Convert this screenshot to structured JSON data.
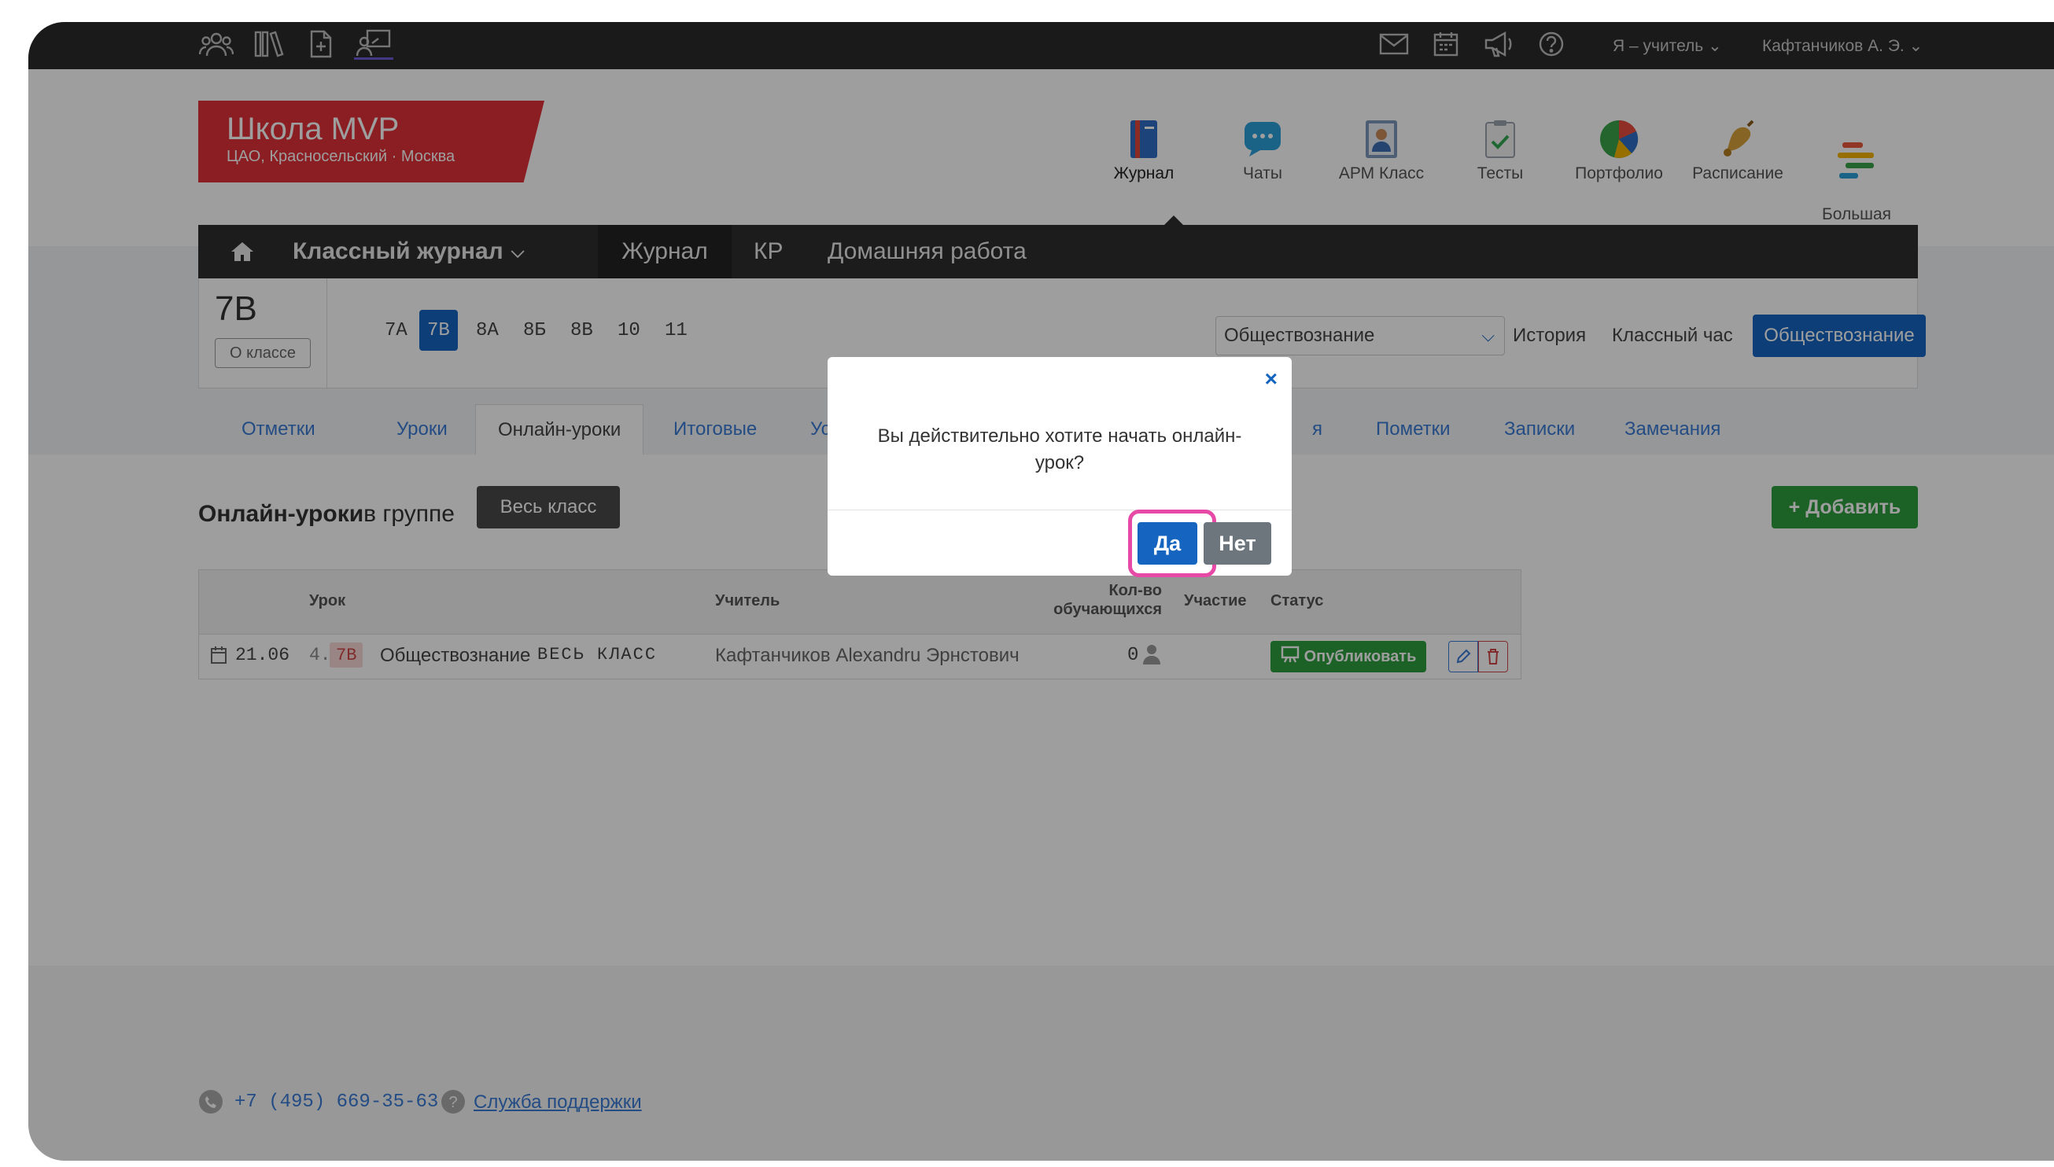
{
  "topbar": {
    "role_menu": "Я – учитель ⌄",
    "user_menu": "Кафтанчиков А. Э. ⌄"
  },
  "school": {
    "name": "Школа MVP",
    "subtitle": "ЦАО, Красносельский · Москва"
  },
  "modules": [
    {
      "label": "Журнал",
      "icon": "journal-icon",
      "color": "#2f6fc6"
    },
    {
      "label": "Чаты",
      "icon": "chat-icon",
      "color": "#2aa0d8"
    },
    {
      "label": "АРМ Класс",
      "icon": "arm-class-icon",
      "color": "#6a87b0"
    },
    {
      "label": "Тесты",
      "icon": "tests-icon",
      "color": "#3aa44a"
    },
    {
      "label": "Портфолио",
      "icon": "portfolio-icon",
      "color": "#e84c3d"
    },
    {
      "label": "Расписание",
      "icon": "bell-icon",
      "color": "#d9a23a"
    },
    {
      "label": "Большая\nперемена",
      "icon": "big-break-icon",
      "color": "#e8593d"
    }
  ],
  "journal_nav": {
    "home_icon": "home-icon",
    "class_journal": "Классный журнал",
    "journal": "Журнал",
    "kr": "КР",
    "homework": "Домашняя работа"
  },
  "class_bar": {
    "current_class": "7В",
    "about_button": "О классе",
    "classes": [
      "7А",
      "7В",
      "8А",
      "8Б",
      "8В",
      "10",
      "11"
    ],
    "active_class_index": 1,
    "subject_select_value": "Обществознание",
    "links": [
      "История",
      "Классный час"
    ],
    "active_subject": "Обществознание"
  },
  "tabs": [
    "Отметки",
    "Уроки",
    "Онлайн-уроки",
    "Итоговые",
    "Успе",
    "я",
    "Пометки",
    "Записки",
    "Замечания"
  ],
  "active_tab_index": 2,
  "section": {
    "title_bold": "Онлайн-уроки",
    "title_rest": " в группе",
    "group_button": "Весь класс",
    "add_button": "+ Добавить"
  },
  "table": {
    "headers": {
      "lesson": "Урок",
      "teacher": "Учитель",
      "count": "Кол-во\nобучающихся",
      "participation": "Участие",
      "status": "Статус"
    },
    "rows": [
      {
        "date": "21.06",
        "number": "4.",
        "class_badge": "7В",
        "subject": "Обществознание",
        "group": "ВЕСЬ КЛАСС",
        "teacher": "Кафтанчиков Alexandru Эрнстович",
        "count": "0",
        "publish_button": "Опубликовать"
      }
    ]
  },
  "footer": {
    "phone": "+7 (495) 669-35-63",
    "support": "Служба поддержки"
  },
  "modal": {
    "message": "Вы действительно хотите начать онлайн-\nурок?",
    "yes": "Да",
    "no": "Нет"
  },
  "colors": {
    "brand_red": "#e03137",
    "primary_blue": "#1565c0",
    "success_green": "#2e9e3f",
    "highlight_pink": "#e64aa6",
    "dark_nav": "#2e2e2e"
  }
}
